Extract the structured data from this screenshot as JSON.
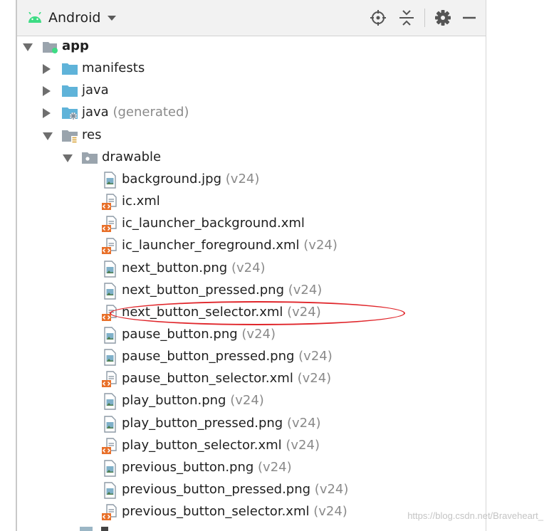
{
  "toolbar": {
    "view_label": "Android",
    "icons": [
      "locate-icon",
      "collapse-all-icon",
      "gear-icon",
      "minimize-icon"
    ]
  },
  "tree": [
    {
      "name": "app",
      "suffix": "",
      "icon": "module",
      "arrow": "expanded",
      "bold": true
    },
    {
      "name": "manifests",
      "suffix": "",
      "icon": "folder",
      "arrow": "collapsed"
    },
    {
      "name": "java",
      "suffix": "",
      "icon": "folder",
      "arrow": "collapsed"
    },
    {
      "name": "java",
      "suffix": " (generated)",
      "icon": "folder-generated",
      "arrow": "collapsed"
    },
    {
      "name": "res",
      "suffix": "",
      "icon": "res-folder",
      "arrow": "expanded"
    },
    {
      "name": "drawable",
      "suffix": "",
      "icon": "package-folder",
      "arrow": "expanded"
    },
    {
      "name": "background.jpg",
      "suffix": " (v24)",
      "icon": "image-file"
    },
    {
      "name": "ic.xml",
      "suffix": "",
      "icon": "xml-file"
    },
    {
      "name": "ic_launcher_background.xml",
      "suffix": "",
      "icon": "xml-file"
    },
    {
      "name": "ic_launcher_foreground.xml",
      "suffix": " (v24)",
      "icon": "xml-file"
    },
    {
      "name": "next_button.png",
      "suffix": " (v24)",
      "icon": "image-file"
    },
    {
      "name": "next_button_pressed.png",
      "suffix": " (v24)",
      "icon": "image-file"
    },
    {
      "name": "next_button_selector.xml",
      "suffix": " (v24)",
      "icon": "xml-file"
    },
    {
      "name": "pause_button.png",
      "suffix": " (v24)",
      "icon": "image-file"
    },
    {
      "name": "pause_button_pressed.png",
      "suffix": " (v24)",
      "icon": "image-file"
    },
    {
      "name": "pause_button_selector.xml",
      "suffix": " (v24)",
      "icon": "xml-file"
    },
    {
      "name": "play_button.png",
      "suffix": " (v24)",
      "icon": "image-file"
    },
    {
      "name": "play_button_pressed.png",
      "suffix": " (v24)",
      "icon": "image-file"
    },
    {
      "name": "play_button_selector.xml",
      "suffix": " (v24)",
      "icon": "xml-file"
    },
    {
      "name": "previous_button.png",
      "suffix": " (v24)",
      "icon": "image-file"
    },
    {
      "name": "previous_button_pressed.png",
      "suffix": " (v24)",
      "icon": "image-file"
    },
    {
      "name": "previous_button_selector.xml",
      "suffix": " (v24)",
      "icon": "xml-file"
    }
  ],
  "colors": {
    "annotation": "#e0262b",
    "folder": "#5fb3d9",
    "xml_badge": "#e8702a",
    "android_green": "#3ddc84",
    "suffix_gray": "#8a8a8a"
  },
  "watermark": "https://blog.csdn.net/Braveheart_"
}
